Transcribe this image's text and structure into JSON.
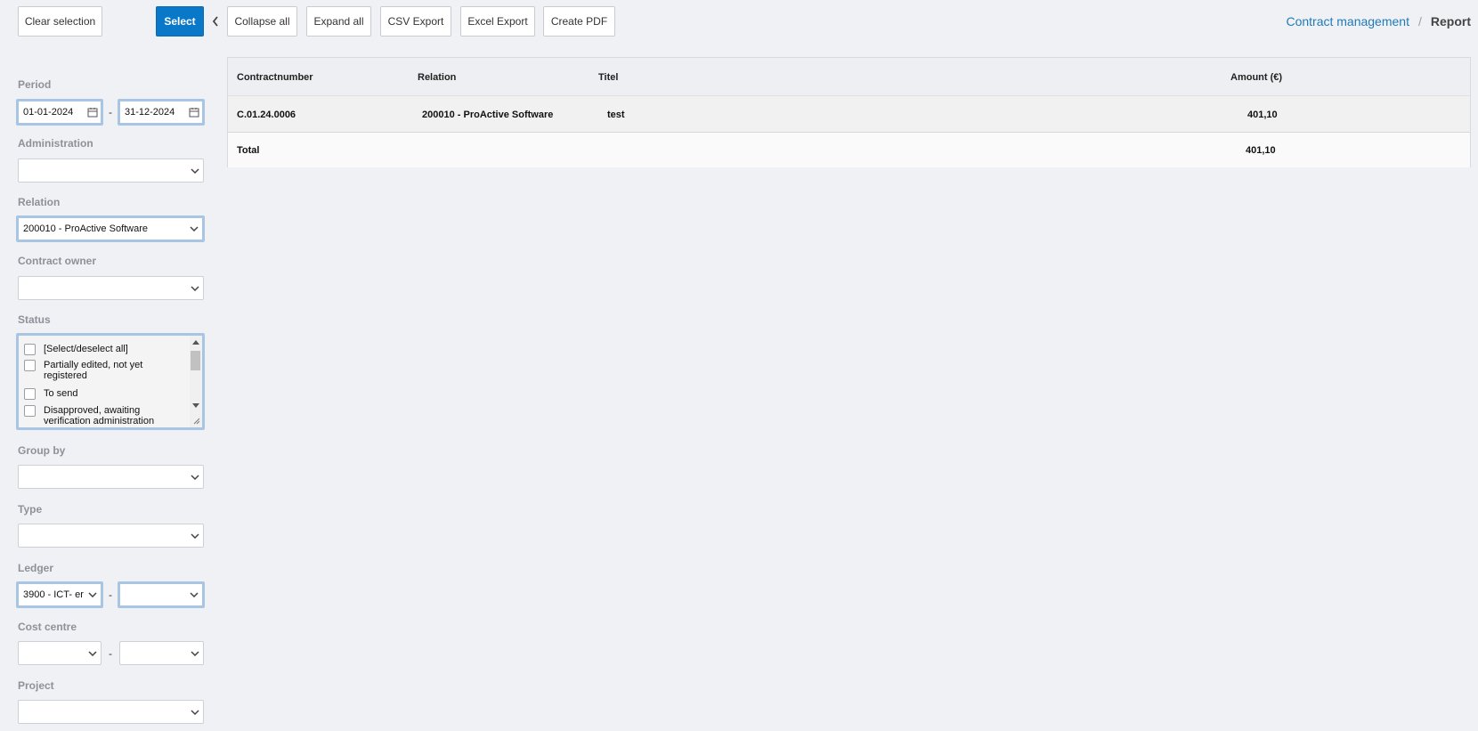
{
  "toolbar": {
    "clear_selection": "Clear selection",
    "select": "Select",
    "collapse_all": "Collapse all",
    "expand_all": "Expand all",
    "csv_export": "CSV Export",
    "excel_export": "Excel Export",
    "create_pdf": "Create PDF"
  },
  "breadcrumb": {
    "parent": "Contract management",
    "separator": "/",
    "current": "Report"
  },
  "filters": {
    "period": {
      "label": "Period",
      "from": "01-01-2024",
      "to": "31-12-2024",
      "separator": "-"
    },
    "administration": {
      "label": "Administration",
      "value": ""
    },
    "relation": {
      "label": "Relation",
      "value": "200010 - ProActive Software"
    },
    "contract_owner": {
      "label": "Contract owner",
      "value": ""
    },
    "status": {
      "label": "Status",
      "options": [
        "[Select/deselect all]",
        "Partially edited, not yet registered",
        "To send",
        "Disapproved, awaiting verification administration"
      ]
    },
    "group_by": {
      "label": "Group by",
      "value": ""
    },
    "type": {
      "label": "Type",
      "value": ""
    },
    "ledger": {
      "label": "Ledger",
      "from": "3900 - ICT- er",
      "to": "",
      "separator": "-"
    },
    "cost_centre": {
      "label": "Cost centre",
      "from": "",
      "to": "",
      "separator": "-"
    },
    "project": {
      "label": "Project",
      "value": ""
    }
  },
  "table": {
    "columns": [
      "Contractnumber",
      "Relation",
      "Titel",
      "Amount (€)"
    ],
    "rows": [
      {
        "contractnumber": "C.01.24.0006",
        "relation": "200010 - ProActive Software",
        "titel": "test",
        "amount": "401,10"
      }
    ],
    "total": {
      "label": "Total",
      "amount": "401,10"
    }
  },
  "colors": {
    "primary": "#0a78c8",
    "link": "#1f7ab8",
    "focus_border": "#a8c6e3",
    "background": "#f0f1f5"
  },
  "icons": [
    "chevron-left-icon",
    "calendar-icon",
    "chevron-down-icon"
  ]
}
